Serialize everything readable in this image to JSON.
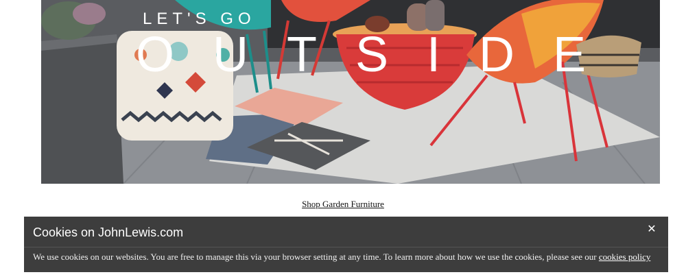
{
  "hero": {
    "kicker": "LET'S GO",
    "title": "OUTSIDE"
  },
  "shop_link": {
    "label": "Shop Garden Furniture"
  },
  "cookie_banner": {
    "title": "Cookies on JohnLewis.com",
    "close_glyph": "✕",
    "message": "We use cookies on our websites. You are free to manage this via your browser setting at any time. To learn more about how we use the cookies, please see our ",
    "policy_link": "cookies policy",
    "background_color": "#3d3d3d"
  }
}
